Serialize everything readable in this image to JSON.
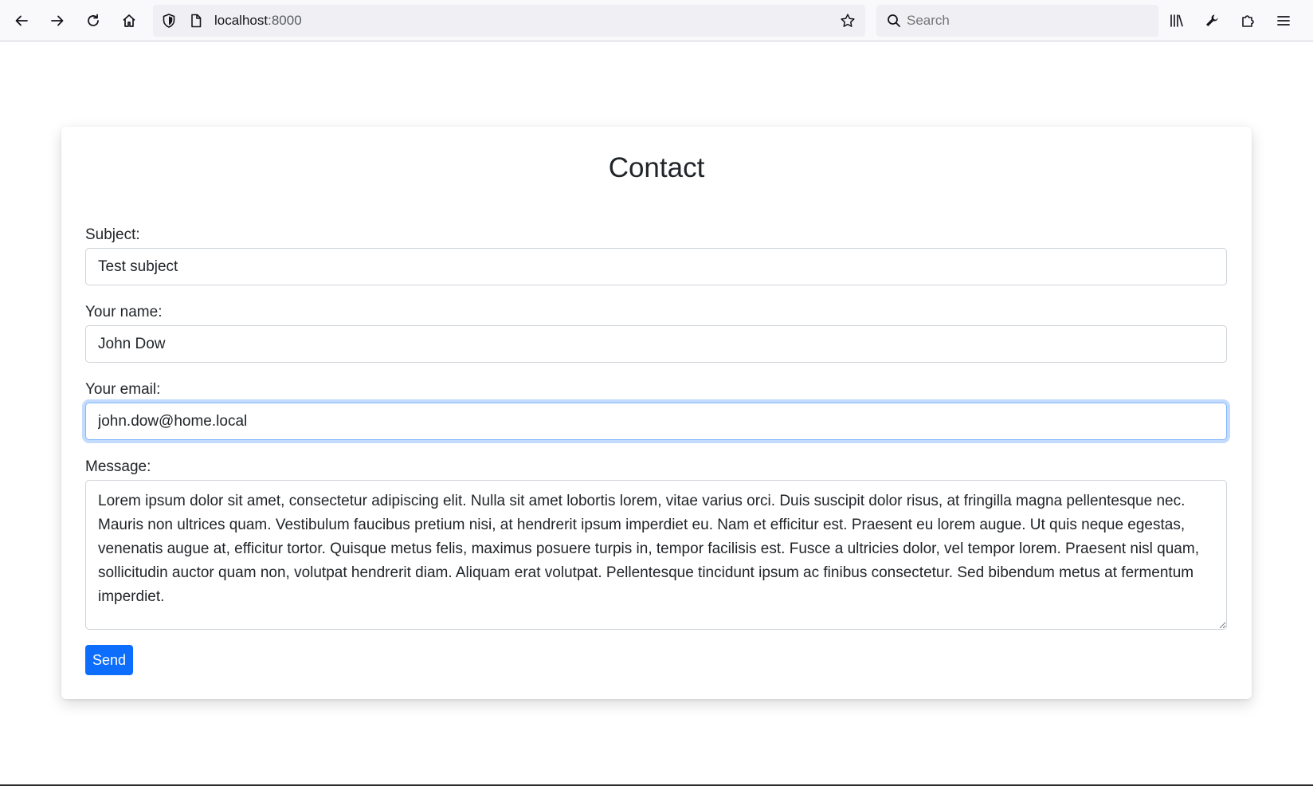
{
  "browser": {
    "url_host": "localhost",
    "url_port": ":8000",
    "search_placeholder": "Search",
    "icons": {
      "back": "arrow-left-icon",
      "forward": "arrow-right-icon",
      "reload": "reload-icon",
      "home": "home-icon",
      "tracking": "shield-icon",
      "page": "page-icon",
      "bookmark": "star-icon",
      "search": "search-icon",
      "library": "library-icon",
      "customize": "wrench-icon",
      "extensions": "puzzle-icon",
      "menu": "hamburger-menu-icon"
    }
  },
  "form": {
    "title": "Contact",
    "subject_label": "Subject:",
    "subject_value": "Test subject",
    "name_label": "Your name:",
    "name_value": "John Dow",
    "email_label": "Your email:",
    "email_value": "john.dow@home.local",
    "message_label": "Message:",
    "message_value": "Lorem ipsum dolor sit amet, consectetur adipiscing elit. Nulla sit amet lobortis lorem, vitae varius orci. Duis suscipit dolor risus, at fringilla magna pellentesque nec. Mauris non ultrices quam. Vestibulum faucibus pretium nisi, at hendrerit ipsum imperdiet eu. Nam et efficitur est. Praesent eu lorem augue. Ut quis neque egestas, venenatis augue at, efficitur tortor. Quisque metus felis, maximus posuere turpis in, tempor facilisis est. Fusce a ultricies dolor, vel tempor lorem. Praesent nisl quam, sollicitudin auctor quam non, volutpat hendrerit diam. Aliquam erat volutpat. Pellentesque tincidunt ipsum ac finibus consectetur. Sed bibendum metus at fermentum imperdiet.",
    "send_label": "Send"
  },
  "colors": {
    "primary": "#0d6efd",
    "focus_border": "#86b7fe",
    "input_border": "#ced4da",
    "text": "#212529"
  }
}
